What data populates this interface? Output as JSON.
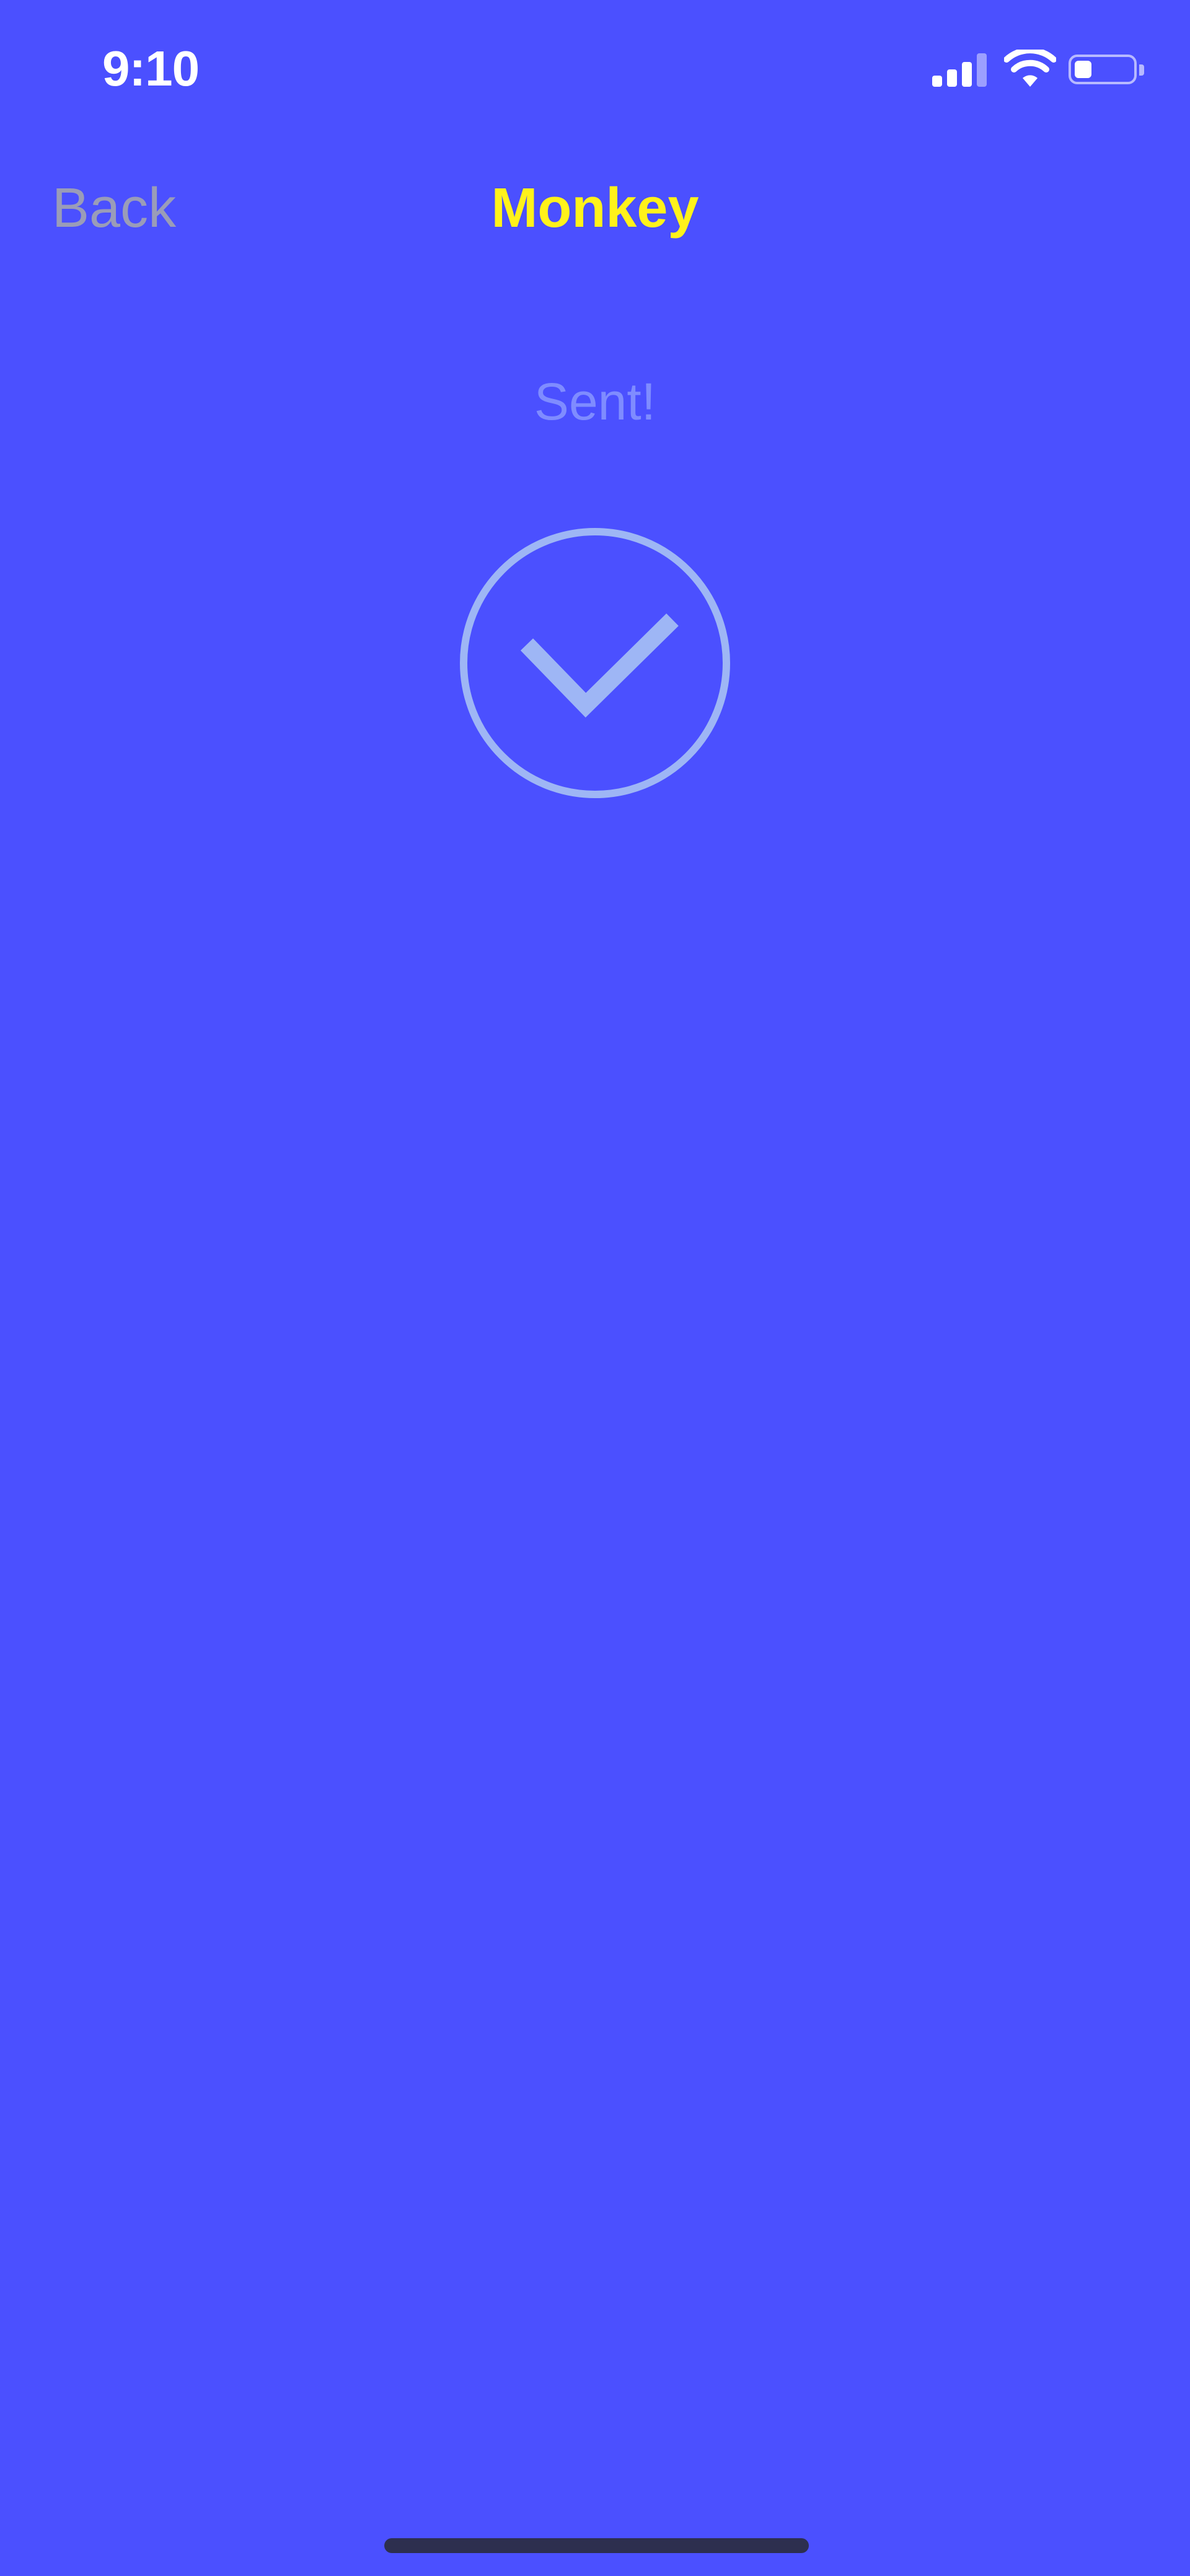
{
  "status_bar": {
    "time": "9:10",
    "signal_icon": "cellular-signal-icon",
    "wifi_icon": "wifi-icon",
    "battery_icon": "battery-icon",
    "battery_level": 0.3
  },
  "nav": {
    "back_label": "Back",
    "title": "Monkey"
  },
  "content": {
    "status_text": "Sent!",
    "success_icon": "checkmark-circle-icon"
  },
  "colors": {
    "background": "#4B50FF",
    "title": "#FFF21A",
    "back": "#9A9CB8",
    "status_text": "#7F8CFF",
    "check": "#9EB6F5"
  }
}
